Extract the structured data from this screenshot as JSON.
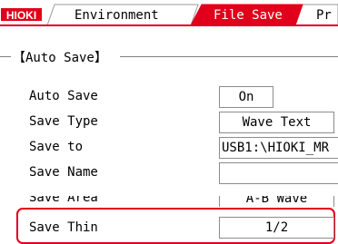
{
  "header": {
    "logo": "HIOKI",
    "tabs": [
      {
        "label": "Environment",
        "active": false
      },
      {
        "label": "File Save",
        "active": true
      },
      {
        "label": "Pr",
        "active": false
      }
    ]
  },
  "section": {
    "title": "【Auto Save】"
  },
  "rows": [
    {
      "label": "Auto Save",
      "value": "On"
    },
    {
      "label": "Save Type",
      "value": "Wave Text"
    },
    {
      "label": "Save to",
      "value": "USB1:\\HIOKI_MR"
    },
    {
      "label": "Save Name",
      "value": ""
    },
    {
      "label": "Save Area",
      "value": "A-B Wave"
    },
    {
      "label": "Save Thin",
      "value": "1/2"
    }
  ],
  "colors": {
    "accent": "#e0001b",
    "active_tab_text": "#ffffff"
  }
}
